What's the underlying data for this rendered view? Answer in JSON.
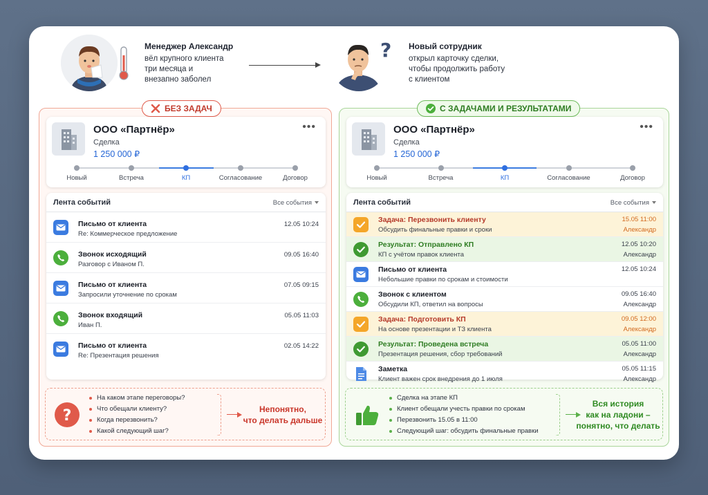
{
  "story": {
    "manager": {
      "title": "Менеджер Александр",
      "lines": [
        "вёл крупного клиента",
        "три месяца и",
        "внезапно заболел"
      ]
    },
    "newcomer": {
      "title": "Новый сотрудник",
      "lines": [
        "открыл карточку сделки,",
        "чтобы продолжить работу",
        "с клиентом"
      ]
    }
  },
  "left": {
    "badge": "БЕЗ ЗАДАЧ",
    "deal": {
      "name": "ООО «Партнёр»",
      "type": "Сделка",
      "sum": "1 250 000 ₽",
      "menu": "•••"
    },
    "stages": [
      {
        "label": "Новый"
      },
      {
        "label": "Встреча"
      },
      {
        "label": "КП"
      },
      {
        "label": "Согласование"
      },
      {
        "label": "Договор"
      }
    ],
    "active_stage_index": 2,
    "feed": {
      "title": "Лента событий",
      "filter": "Все события",
      "rows": [
        {
          "kind": "mail",
          "title": "Письмо от клиента",
          "sub": "Re: Коммерческое предложение",
          "date": "12.05 10:24"
        },
        {
          "kind": "call",
          "title": "Звонок исходящий",
          "sub": "Разговор с Иваном П.",
          "date": "09.05 16:40"
        },
        {
          "kind": "mail",
          "title": "Письмо от клиента",
          "sub": "Запросили уточнение по срокам",
          "date": "07.05 09:15"
        },
        {
          "kind": "call",
          "title": "Звонок входящий",
          "sub": "Иван П.",
          "date": "05.05 11:03"
        },
        {
          "kind": "mail",
          "title": "Письмо от клиента",
          "sub": "Re: Презентация решения",
          "date": "02.05 14:22"
        }
      ]
    },
    "summary": {
      "items": [
        "На каком этапе переговоры?",
        "Что обещали клиенту?",
        "Когда перезвонить?",
        "Какой следующий шаг?"
      ],
      "conclusion": [
        "Непонятно,",
        "что делать дальше"
      ]
    }
  },
  "right": {
    "badge": "С ЗАДАЧАМИ И РЕЗУЛЬТАТАМИ",
    "deal": {
      "name": "ООО «Партнёр»",
      "type": "Сделка",
      "sum": "1 250 000 ₽",
      "menu": "•••"
    },
    "stages": [
      {
        "label": "Новый"
      },
      {
        "label": "Встреча"
      },
      {
        "label": "КП"
      },
      {
        "label": "Согласование"
      },
      {
        "label": "Договор"
      }
    ],
    "active_stage_index": 2,
    "feed": {
      "title": "Лента событий",
      "filter": "Все события",
      "rows": [
        {
          "kind": "task",
          "title": "Задача: Перезвонить клиенту",
          "sub": "Обсудить финальные правки и сроки",
          "date": "15.05 11:00",
          "name": "Александр"
        },
        {
          "kind": "result",
          "title": "Результат: Отправлено КП",
          "sub": "КП с учётом правок клиента",
          "date": "12.05 10:20",
          "name": "Александр"
        },
        {
          "kind": "mail",
          "title": "Письмо от клиента",
          "sub": "Небольшие правки по срокам и стоимости",
          "date": "12.05 10:24",
          "name": ""
        },
        {
          "kind": "call",
          "title": "Звонок с клиентом",
          "sub": "Обсудили КП, ответил на вопросы",
          "date": "09.05 16:40",
          "name": "Александр"
        },
        {
          "kind": "task",
          "title": "Задача: Подготовить КП",
          "sub": "На основе презентации и ТЗ клиента",
          "date": "09.05 12:00",
          "name": "Александр"
        },
        {
          "kind": "result",
          "title": "Результат: Проведена встреча",
          "sub": "Презентация решения, сбор требований",
          "date": "05.05 11:00",
          "name": "Александр"
        },
        {
          "kind": "note",
          "title": "Заметка",
          "sub": "Клиент важен срок внедрения до 1 июля",
          "date": "05.05 11:15",
          "name": "Александр"
        }
      ]
    },
    "summary": {
      "items": [
        "Сделка на этапе КП",
        "Клиент обещали учесть правки по срокам",
        "Перезвонить 15.05 в 11:00",
        "Следующий шаг: обсудить финальные правки"
      ],
      "conclusion": [
        "Вся история",
        "как на ладони –",
        "понятно, что делать"
      ]
    }
  },
  "colors": {
    "red": "#e05a4a",
    "green": "#5bb04a",
    "blue": "#2f6fe0",
    "task_bg": "#fdf3d8",
    "result_bg": "#eaf6e4"
  }
}
